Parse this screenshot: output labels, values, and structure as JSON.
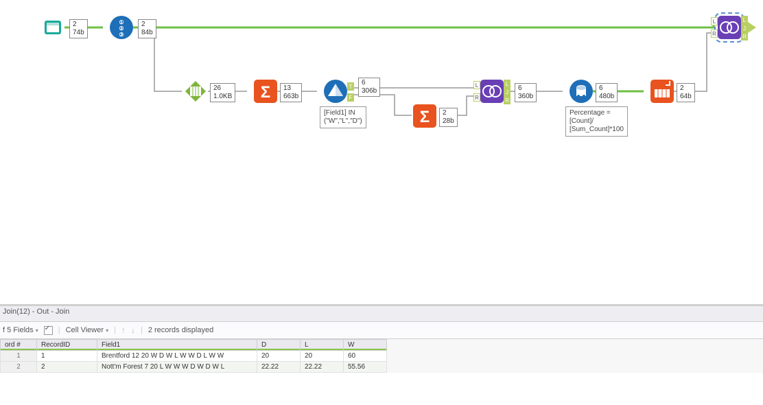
{
  "canvas": {
    "tools": {
      "input": {
        "rows": "2",
        "size": "74b"
      },
      "recordid": {
        "rows": "2",
        "size": "84b"
      },
      "text2col": {
        "rows": "26",
        "size": "1.0KB"
      },
      "summarize1": {
        "rows": "13",
        "size": "663b"
      },
      "filter": {
        "rowsT": "6",
        "sizeT": "306b",
        "annotation": "[Field1] IN\n(\"W\",\"L\",\"D\")"
      },
      "summarize2": {
        "rows": "2",
        "size": "28b"
      },
      "join1": {
        "rows": "6",
        "size": "360b"
      },
      "formula": {
        "rows": "6",
        "size": "480b",
        "annotation": "Percentage =\n[Count]/\n[Sum_Count]*100"
      },
      "crosstab": {
        "rows": "2",
        "size": "64b"
      },
      "join2": {}
    }
  },
  "results": {
    "title": "Join(12) - Out - Join",
    "fields_label": "f 5 Fields",
    "cellviewer_label": "Cell Viewer",
    "records_label": "2 records displayed",
    "columns": [
      "ord #",
      "RecordID",
      "Field1",
      "D",
      "L",
      "W"
    ],
    "rows": [
      {
        "n": "1",
        "RecordID": "1",
        "Field1": "Brentford 12 20 W D W L W W D L W W",
        "D": "20",
        "L": "20",
        "W": "60"
      },
      {
        "n": "2",
        "RecordID": "2",
        "Field1": "Nott'm Forest 7 20 L W W W D W D W L",
        "D": "22.22",
        "L": "22.22",
        "W": "55.56"
      }
    ]
  }
}
